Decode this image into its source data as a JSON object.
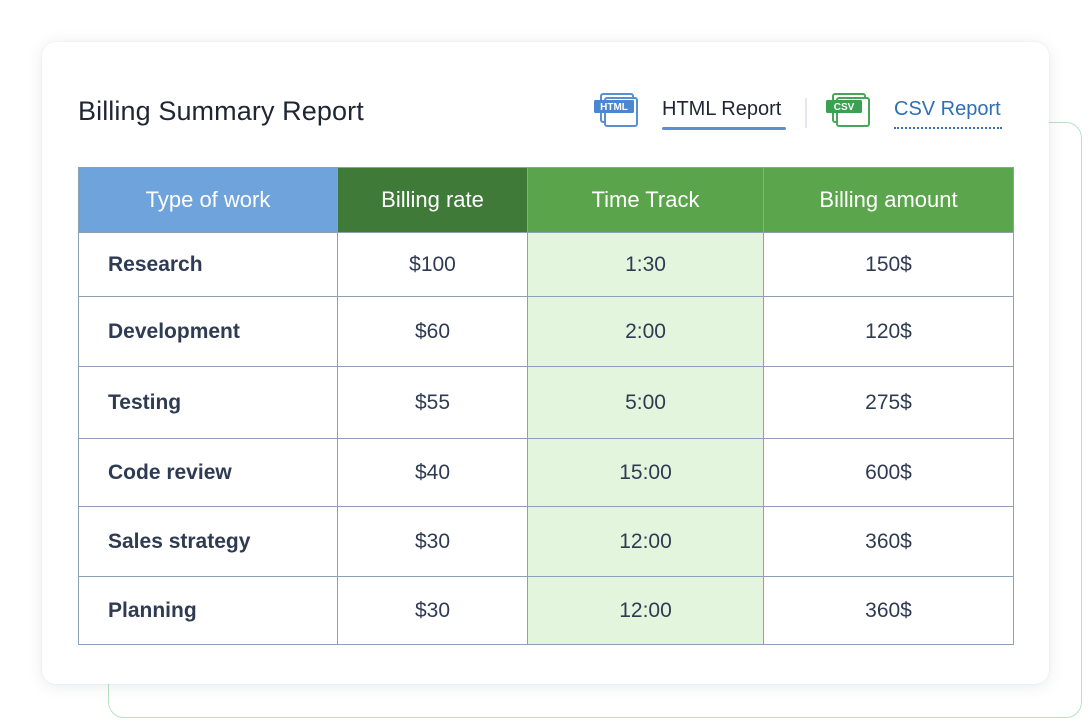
{
  "report": {
    "title": "Billing Summary Report",
    "html_link": {
      "badge": "HTML",
      "label": "HTML Report"
    },
    "csv_link": {
      "badge": "CSV",
      "label": "CSV Report"
    }
  },
  "table": {
    "headers": [
      "Type of work",
      "Billing rate",
      "Time Track",
      "Billing amount"
    ],
    "rows": [
      {
        "work": "Research",
        "rate": "$100",
        "time": "1:30",
        "amount": "150$"
      },
      {
        "work": "Development",
        "rate": "$60",
        "time": "2:00",
        "amount": "120$"
      },
      {
        "work": "Testing",
        "rate": "$55",
        "time": "5:00",
        "amount": "275$"
      },
      {
        "work": "Code review",
        "rate": "$40",
        "time": "15:00",
        "amount": "600$"
      },
      {
        "work": "Sales strategy",
        "rate": "$30",
        "time": "12:00",
        "amount": "360$"
      },
      {
        "work": "Planning",
        "rate": "$30",
        "time": "12:00",
        "amount": "360$"
      }
    ]
  },
  "colors": {
    "header_type": "#6fa3dc",
    "header_rate": "#3f7a38",
    "header_time": "#5aa44c",
    "header_amount": "#5ba54d",
    "time_column_bg": "#e3f5dd",
    "csv_link": "#2f6fb3",
    "html_underline": "#5b8fd2"
  }
}
